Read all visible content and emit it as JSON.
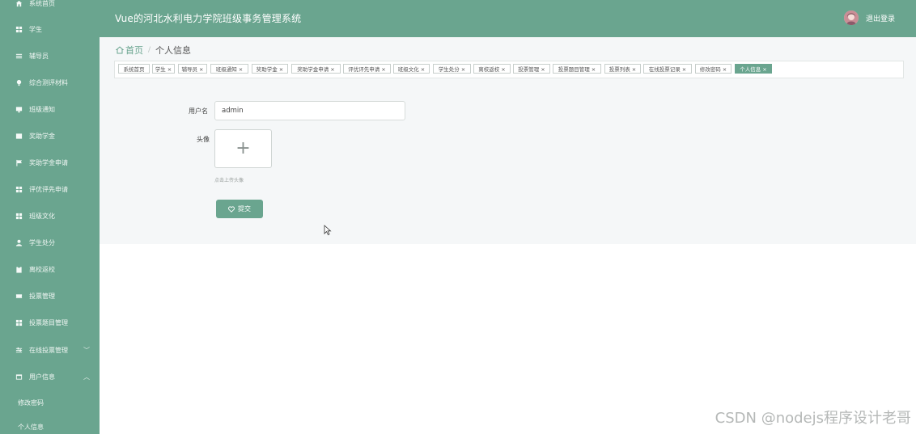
{
  "header": {
    "title": "Vue的河北水利电力学院班级事务管理系统",
    "logout_label": "退出登录"
  },
  "colors": {
    "primary": "#6aa58f",
    "sidebar": "#6aa58f",
    "content_bg": "#f5f7f8"
  },
  "sidebar": {
    "items": [
      {
        "label": "系统首页",
        "icon": "home-icon"
      },
      {
        "label": "学生",
        "icon": "grid-icon"
      },
      {
        "label": "辅导员",
        "icon": "menu-icon"
      },
      {
        "label": "综合测评材料",
        "icon": "lightbulb-icon"
      },
      {
        "label": "班级通知",
        "icon": "monitor-icon"
      },
      {
        "label": "奖助学金",
        "icon": "wallet-icon"
      },
      {
        "label": "奖助学金申请",
        "icon": "flag-icon"
      },
      {
        "label": "评优评先申请",
        "icon": "grid-icon"
      },
      {
        "label": "班级文化",
        "icon": "grid-icon"
      },
      {
        "label": "学生处分",
        "icon": "user-icon"
      },
      {
        "label": "离校返校",
        "icon": "clipboard-icon"
      },
      {
        "label": "投票管理",
        "icon": "ticket-icon"
      },
      {
        "label": "投票题目管理",
        "icon": "grid-icon"
      },
      {
        "label": "在线投票管理",
        "icon": "sliders-icon",
        "arrow": "﹀"
      },
      {
        "label": "用户信息",
        "icon": "card-icon",
        "arrow": "︿"
      }
    ],
    "sub_items": [
      {
        "label": "修改密码"
      },
      {
        "label": "个人信息"
      }
    ]
  },
  "breadcrumb": {
    "home": "首页",
    "separator": "/",
    "current": "个人信息"
  },
  "tags": [
    {
      "label": "系统首页"
    },
    {
      "label": "学生 ×"
    },
    {
      "label": "辅导员 ×"
    },
    {
      "label": "班级通知 ×"
    },
    {
      "label": "奖助学金 ×"
    },
    {
      "label": "奖助学金申请 ×"
    },
    {
      "label": "评优评先申请 ×"
    },
    {
      "label": "班级文化 ×"
    },
    {
      "label": "学生处分 ×"
    },
    {
      "label": "离校返校 ×"
    },
    {
      "label": "投票管理 ×"
    },
    {
      "label": "投票题目管理 ×"
    },
    {
      "label": "投票列表 ×"
    },
    {
      "label": "在线投票记录 ×"
    },
    {
      "label": "修改密码 ×"
    },
    {
      "label": "个人信息 ×",
      "active": true
    }
  ],
  "form": {
    "username_label": "用户名",
    "username_value": "admin",
    "avatar_label": "头像",
    "upload_hint": "点击上传头像",
    "submit_label": "提交"
  },
  "watermark": "CSDN @nodejs程序设计老哥"
}
